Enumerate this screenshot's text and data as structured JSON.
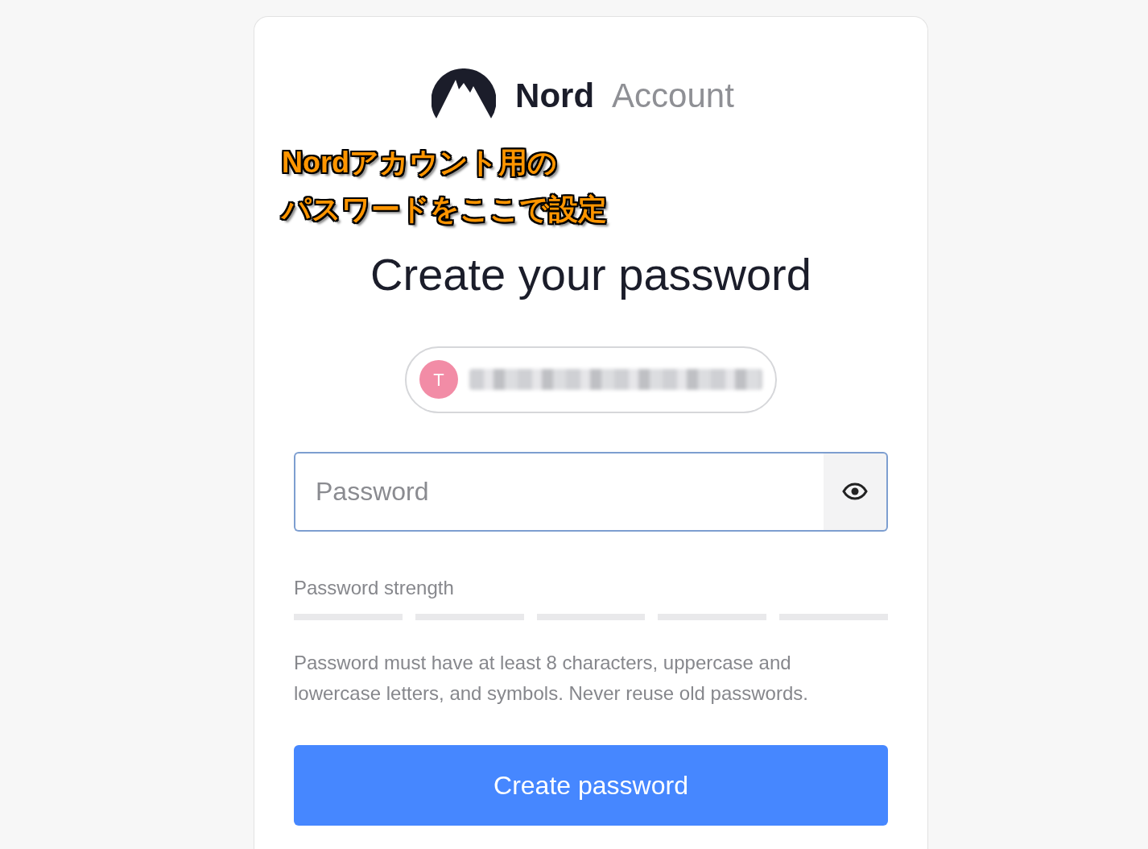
{
  "logo": {
    "brand": "Nord",
    "product": "Account"
  },
  "annotation": {
    "lines": [
      "Nordアカウント用の",
      "パスワードをここで設定"
    ]
  },
  "heading": "Create your password",
  "account": {
    "initial": "T",
    "color": "#f28ca6"
  },
  "password_field": {
    "placeholder": "Password"
  },
  "strength": {
    "label": "Password strength"
  },
  "hint": "Password must have at least 8 characters, uppercase and lowercase letters, and symbols. Never reuse old passwords.",
  "submit_button": "Create password"
}
